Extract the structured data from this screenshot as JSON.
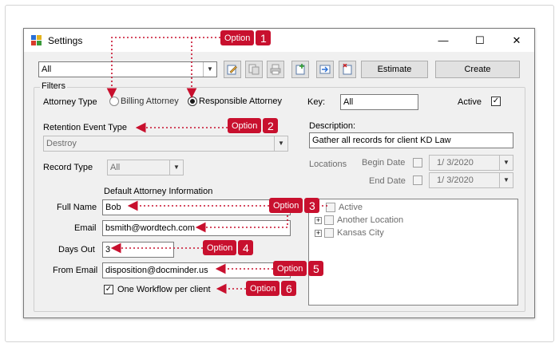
{
  "window": {
    "title": "Settings",
    "minimize_glyph": "—",
    "maximize_glyph": "☐",
    "close_glyph": "✕"
  },
  "toolbar": {
    "selector_value": "All",
    "tools": [
      "edit-icon",
      "copy-icon",
      "print-icon",
      "new-icon",
      "export-icon",
      "delete-icon"
    ],
    "estimate_label": "Estimate",
    "create_label": "Create"
  },
  "filters": {
    "group_title": "Filters",
    "attorney_type_label": "Attorney Type",
    "billing_attorney_label": "Billing Attorney",
    "responsible_attorney_label": "Responsible Attorney",
    "selected_attorney_type": "Responsible Attorney",
    "key_label": "Key:",
    "key_value": "All",
    "active_label": "Active",
    "active_checked": true,
    "check_glyph": "✓",
    "retention_event_type_label": "Retention Event Type",
    "retention_event_type_value": "Destroy",
    "description_label": "Description:",
    "description_value": "Gather all records for client KD Law",
    "locations_label": "Locations",
    "begin_date_label": "Begin Date",
    "begin_date_value": "1/  3/2020",
    "end_date_label": "End Date",
    "end_date_value": "1/  3/2020",
    "record_type_label": "Record Type",
    "record_type_value": "All",
    "default_attorney_info_label": "Default Attorney Information",
    "full_name_label": "Full Name",
    "full_name_value": "Bob",
    "email_label": "Email",
    "email_value": "bsmith@wordtech.com",
    "days_out_label": "Days Out",
    "days_out_value": "3",
    "from_email_label": "From Email",
    "from_email_value": "disposition@docminder.us",
    "one_workflow_label": "One Workflow per client",
    "one_workflow_checked": true,
    "location_tree": [
      {
        "label": "Active",
        "expandable": false
      },
      {
        "label": "Another Location",
        "expandable": true
      },
      {
        "label": "Kansas City",
        "expandable": true
      }
    ],
    "expand_glyph": "+"
  },
  "callouts": [
    {
      "text": "Option",
      "number": "1"
    },
    {
      "text": "Option",
      "number": "2"
    },
    {
      "text": "Option",
      "number": "3"
    },
    {
      "text": "Option",
      "number": "4"
    },
    {
      "text": "Option",
      "number": "5"
    },
    {
      "text": "Option",
      "number": "6"
    }
  ],
  "colors": {
    "callout": "#c8102e",
    "window_bg": "#f0f0f0",
    "field_border": "#7a7a7a"
  }
}
